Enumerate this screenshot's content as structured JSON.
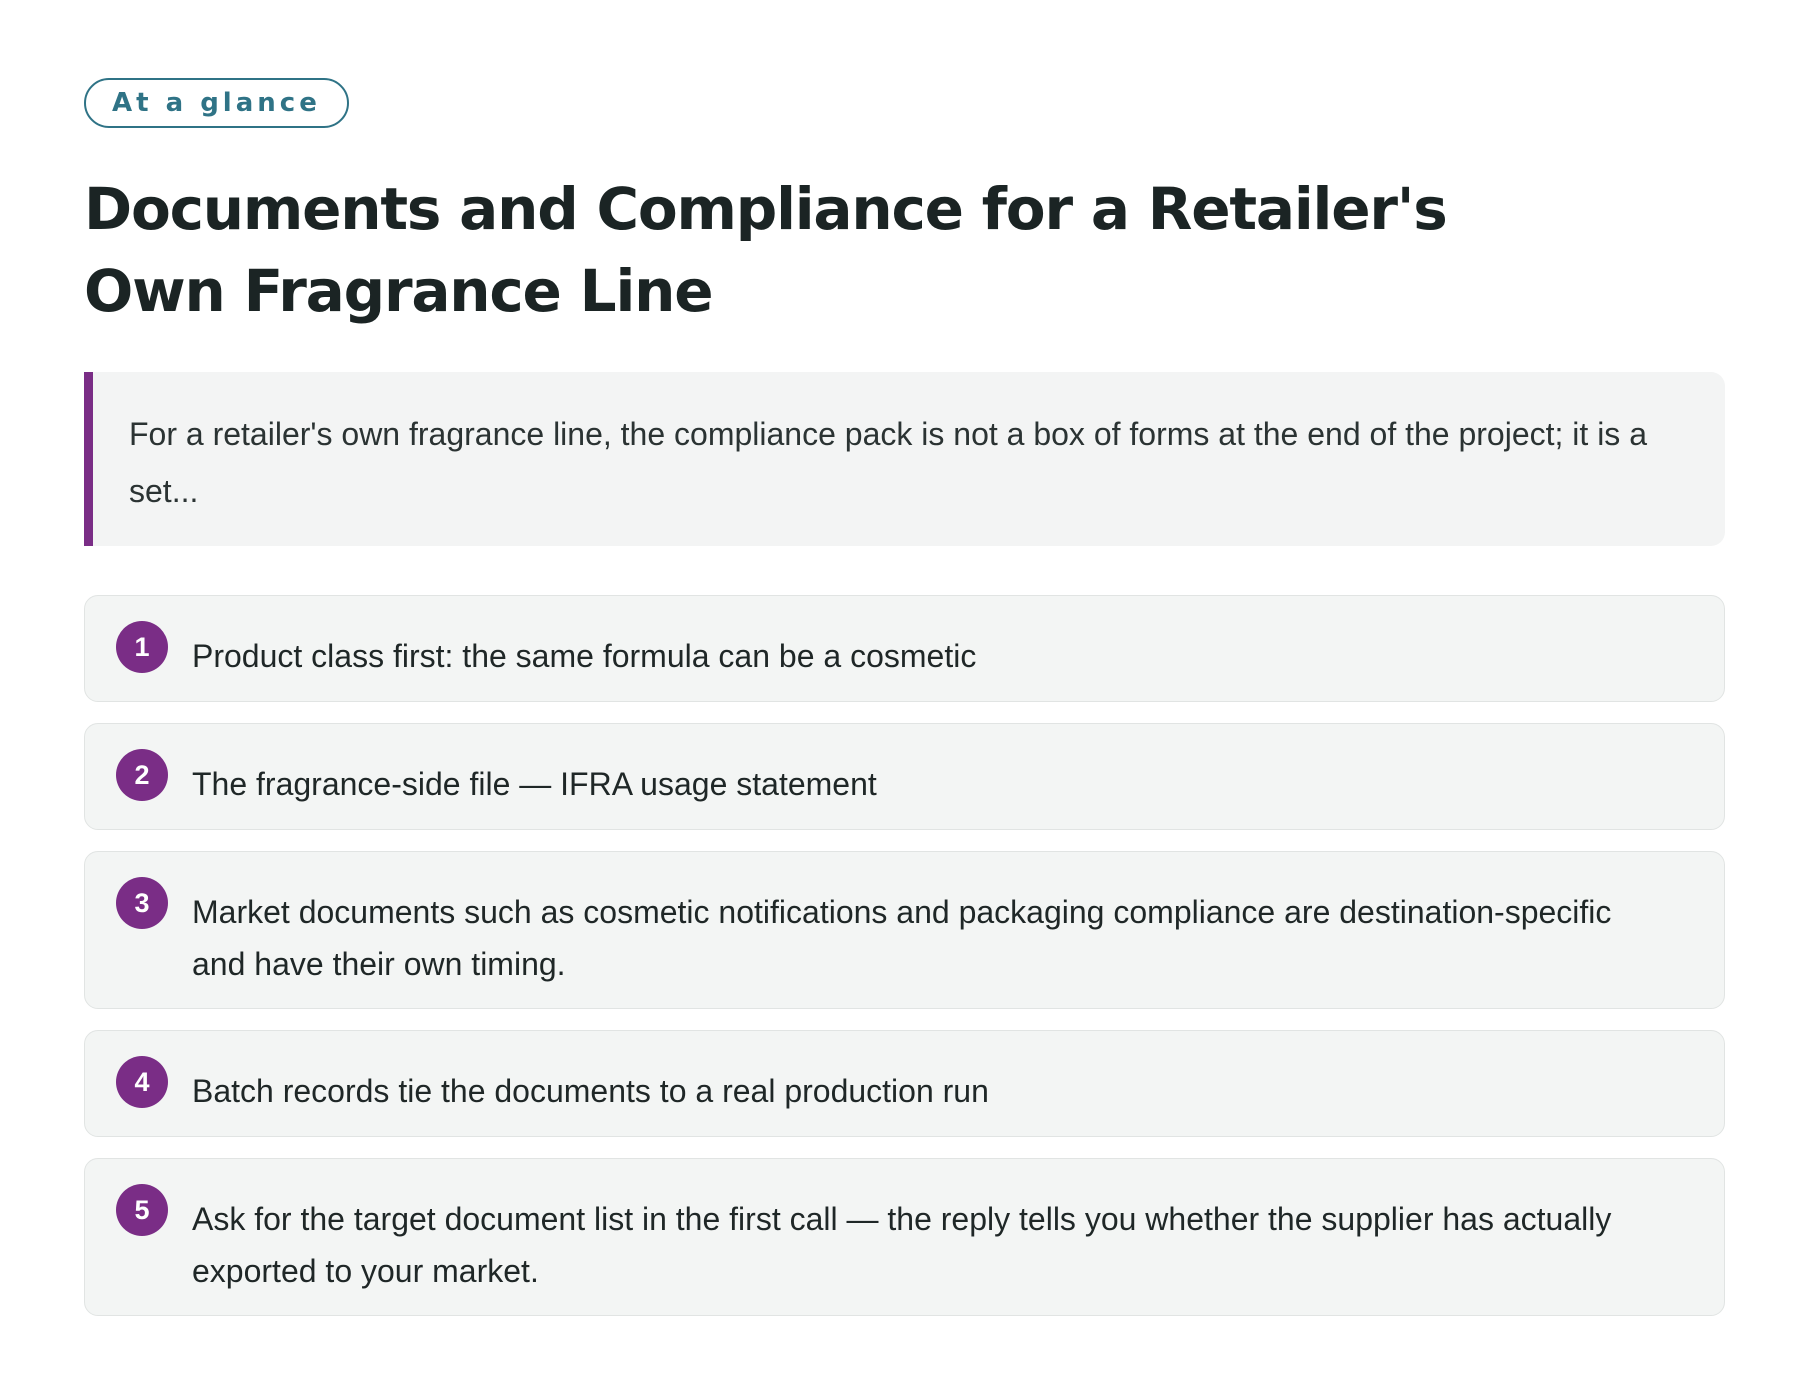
{
  "badge": "At a glance",
  "title": "Documents and Compliance for a Retailer's Own Fragrance Line",
  "summary": "For a retailer's own fragrance line, the compliance pack is not a box of forms at the end of the project; it is a set...",
  "points": [
    {
      "number": "1",
      "text": "Product class first: the same formula can be a cosmetic"
    },
    {
      "number": "2",
      "text": "The fragrance-side file — IFRA usage statement"
    },
    {
      "number": "3",
      "text": "Market documents such as cosmetic notifications and packaging compliance are destination-specific and have their own timing."
    },
    {
      "number": "4",
      "text": "Batch records tie the documents to a real production run"
    },
    {
      "number": "5",
      "text": "Ask for the target document list in the first call — the reply tells you whether the supplier has actually exported to your market."
    }
  ],
  "colors": {
    "accent": "#7a2d86",
    "badge": "#2f7386",
    "card_background": "#f3f5f4"
  }
}
